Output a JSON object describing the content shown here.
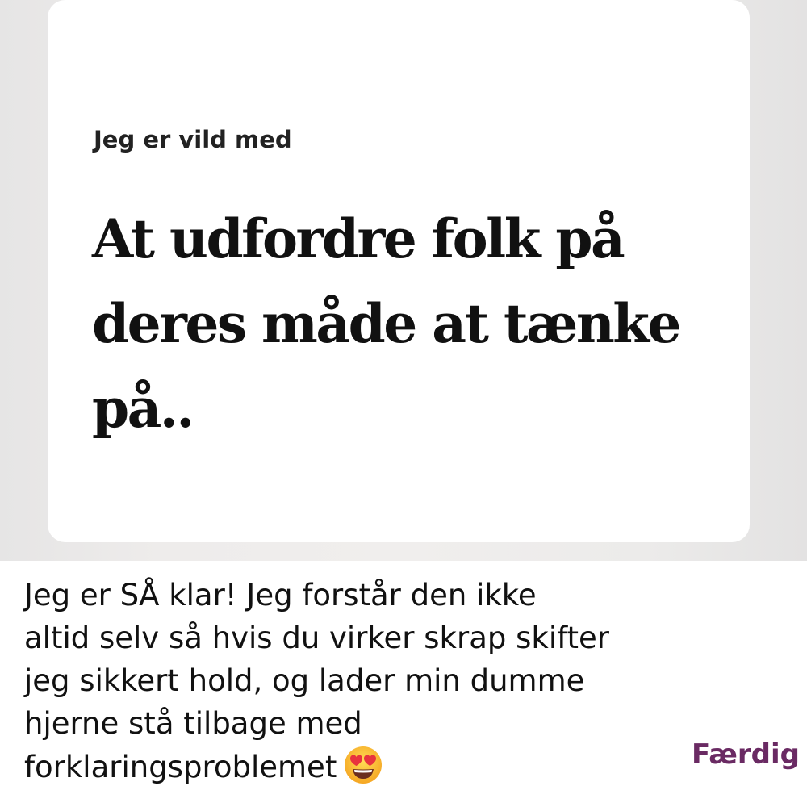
{
  "prompt": {
    "question": "Jeg er vild med",
    "answer": "At udfordre folk på deres måde at tænke på.."
  },
  "reply": {
    "lines": [
      "Jeg er SÅ klar! Jeg forstår den ikke",
      "altid selv så hvis du virker skrap skifter",
      "jeg sikkert hold, og lader min dumme",
      "hjerne stå tilbage med",
      "forklaringsproblemet"
    ],
    "emoji": "heart-eyes-emoji"
  },
  "actions": {
    "done_label": "Færdig"
  },
  "colors": {
    "accent": "#6a2a63",
    "text": "#111111",
    "backdrop": "#eeeceb",
    "card": "#ffffff"
  }
}
